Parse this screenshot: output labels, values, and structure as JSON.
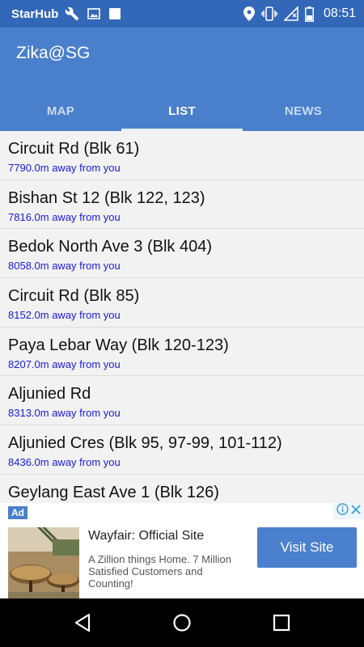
{
  "status_bar": {
    "carrier": "StarHub",
    "time": "08:51",
    "icons": [
      "wrench-icon",
      "image-icon",
      "square-icon",
      "location-icon",
      "vibrate-icon",
      "no-signal-icon",
      "battery-icon"
    ]
  },
  "app_bar": {
    "title": "Zika@SG",
    "background_color": "#4a7fcb",
    "status_color": "#3367b8"
  },
  "tabs": [
    {
      "label": "MAP",
      "active": false
    },
    {
      "label": "LIST",
      "active": true
    },
    {
      "label": "NEWS",
      "active": false
    }
  ],
  "list": {
    "items": [
      {
        "name": "Circuit Rd (Blk 61)",
        "distance": "7790.0m away from you"
      },
      {
        "name": "Bishan St 12 (Blk 122, 123)",
        "distance": "7816.0m away from you"
      },
      {
        "name": "Bedok North Ave 3 (Blk 404)",
        "distance": "8058.0m away from you"
      },
      {
        "name": "Circuit Rd (Blk 85)",
        "distance": "8152.0m away from you"
      },
      {
        "name": "Paya Lebar Way (Blk 120-123)",
        "distance": "8207.0m away from you"
      },
      {
        "name": "Aljunied Rd",
        "distance": "8313.0m away from you"
      },
      {
        "name": "Aljunied Cres (Blk 95, 97-99, 101-112)",
        "distance": "8436.0m away from you"
      },
      {
        "name": "Geylang East Ave 1 (Blk 126)",
        "distance": ""
      }
    ],
    "distance_color": "#1a1ad6"
  },
  "ad": {
    "badge": "Ad",
    "headline": "Wayfair: Official Site",
    "body": "A Zillion things Home. 7 Million Satisfied Customers and Counting!",
    "cta": "Visit Site",
    "choice_icons": [
      "info-icon",
      "close-icon"
    ]
  },
  "nav_bar": {
    "icons": [
      "back-icon",
      "home-icon",
      "recents-icon"
    ]
  }
}
